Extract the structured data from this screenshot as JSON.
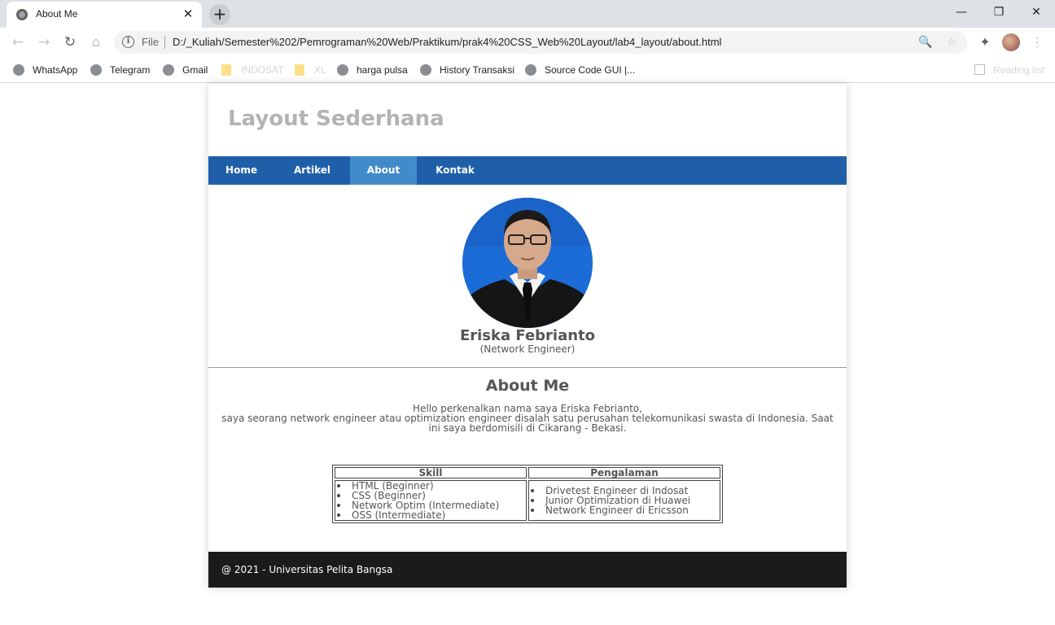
{
  "browser": {
    "tab": {
      "title": "About Me",
      "close": "✕",
      "favicon": "globe-icon"
    },
    "new_tab": "+",
    "window_controls": {
      "minimize": "—",
      "restore": "❐",
      "close": "✕"
    },
    "toolbar": {
      "back": "←",
      "forward": "→",
      "reload": "↻",
      "home": "⌂"
    },
    "address": {
      "info": "i",
      "scheme_label": "File",
      "url": "D:/_Kuliah/Semester%202/Pemrograman%20Web/Praktikum/prak4%20CSS_Web%20Layout/lab4_layout/about.html",
      "zoom_icon": "🔍",
      "star_icon": "☆"
    },
    "extensions": {
      "puzzle": "✦",
      "menu": "⋮"
    },
    "bookmarks": [
      {
        "label": "WhatsApp",
        "icon": "globe-icon"
      },
      {
        "label": "Telegram",
        "icon": "globe-icon"
      },
      {
        "label": "Gmail",
        "icon": "globe-icon"
      },
      {
        "label": "INDOSAT",
        "icon": "folder-icon"
      },
      {
        "label": "XL",
        "icon": "folder-icon"
      },
      {
        "label": "harga pulsa",
        "icon": "globe-icon"
      },
      {
        "label": "History Transaksi",
        "icon": "globe-icon"
      },
      {
        "label": "Source Code GUI |...",
        "icon": "globe-icon"
      }
    ],
    "reading_list": "Reading list"
  },
  "site": {
    "title": "Layout Sederhana",
    "nav": [
      {
        "label": "Home"
      },
      {
        "label": "Artikel"
      },
      {
        "label": "About",
        "active": true
      },
      {
        "label": "Kontak"
      }
    ],
    "profile": {
      "name": "Eriska Febrianto",
      "role": "(Network Engineer)"
    },
    "about": {
      "title": "About Me",
      "line1": "Hello perkenalkan nama saya Eriska Febrianto,",
      "line2": "saya seorang network engineer atau optimization engineer disalah satu perusahan telekomunikasi swasta di Indonesia. Saat ini saya berdomisili di Cikarang - Bekasi."
    },
    "table": {
      "headers": [
        "Skill",
        "Pengalaman"
      ],
      "skills": [
        "HTML (Beginner)",
        "CSS (Beginner)",
        "Network Optim (Intermediate)",
        "OSS (Intermediate)"
      ],
      "experience": [
        "Drivetest Engineer di Indosat",
        "Junior Optimization di Huawei",
        "Network Engineer di Ericsson"
      ]
    },
    "footer": "@ 2021 - Universitas Pelita Bangsa"
  },
  "colors": {
    "nav_bg": "#1f5faa",
    "nav_active": "#428bca",
    "footer_bg": "#1b1b1b",
    "title_gray": "#b3b3b3",
    "text": "#555555"
  }
}
